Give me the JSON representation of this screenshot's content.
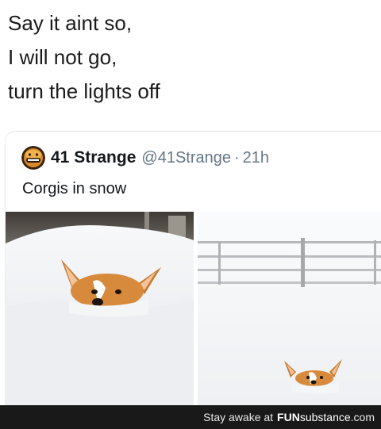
{
  "caption": {
    "lines": [
      "Say it aint so,",
      "I will not go,",
      "turn the lights off"
    ]
  },
  "tweet": {
    "name": "41 Strange",
    "handle": "@41Strange",
    "separator": "·",
    "time": "21h",
    "text": "Corgis in snow",
    "avatar_icon": "smiling-face-avatar",
    "photos": [
      {
        "icon": "corgi-in-snow-closeup-photo"
      },
      {
        "icon": "corgi-in-snow-distant-photo"
      }
    ]
  },
  "footer": {
    "prefix": "Stay awake at",
    "brand_fun": "FUN",
    "brand_rest": "substance",
    "tld": ".com"
  },
  "colors": {
    "background": "#ffffff",
    "text_primary": "#14171a",
    "text_secondary": "#657786",
    "footer_bg": "#191919"
  }
}
